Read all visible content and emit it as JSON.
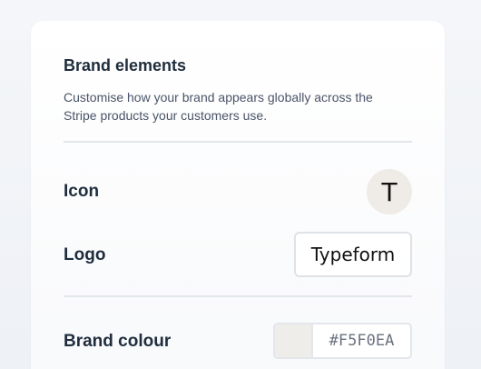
{
  "brand_elements": {
    "title": "Brand elements",
    "description": "Customise how your brand appears globally across the Stripe products your customers use.",
    "icon": {
      "label": "Icon",
      "letter": "T",
      "background": "#EFEBE6"
    },
    "logo": {
      "label": "Logo",
      "text": "Typeform"
    },
    "brand_colour": {
      "label": "Brand colour",
      "value": "#F5F0EA",
      "swatch": "#EFEDEA"
    }
  }
}
